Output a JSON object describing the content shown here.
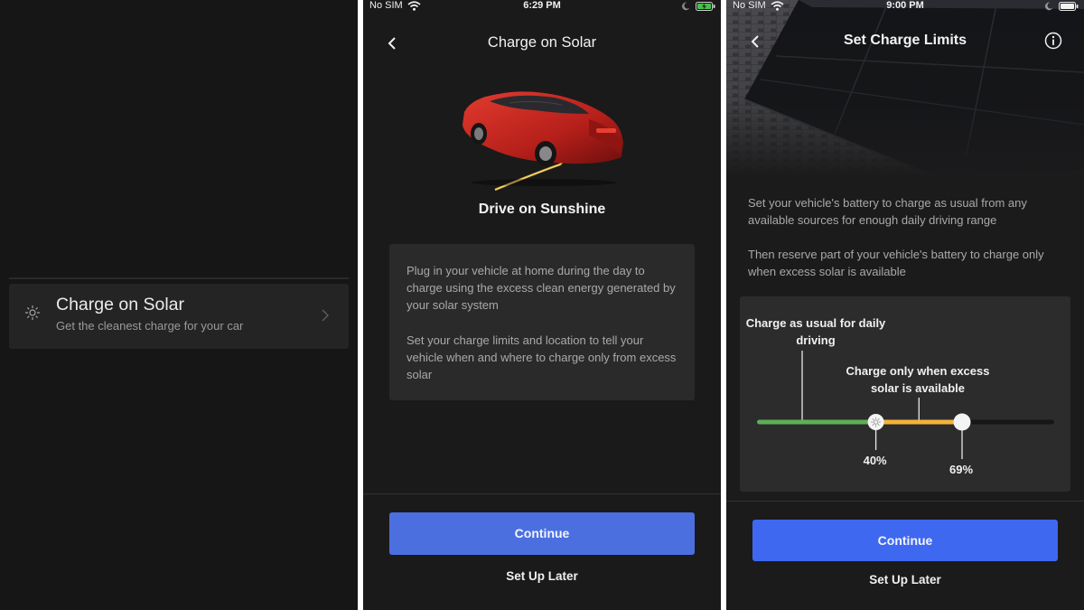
{
  "panel_a": {
    "menu_item": {
      "icon": "sun-icon",
      "title": "Charge on Solar",
      "subtitle": "Get the cleanest charge for your car"
    }
  },
  "panel_b": {
    "status_bar": {
      "carrier": "No SIM",
      "time": "6:29 PM"
    },
    "nav_title": "Charge on Solar",
    "headline": "Drive on Sunshine",
    "info_paragraphs": [
      "Plug in your vehicle at home during the day to charge using the excess clean energy generated by your solar system",
      "Set your charge limits and location to tell your vehicle when and where to charge only from excess solar"
    ],
    "continue_label": "Continue",
    "later_label": "Set Up Later",
    "button_color": "#4c6fe0"
  },
  "panel_c": {
    "status_bar": {
      "carrier": "No SIM",
      "time": "9:00 PM"
    },
    "nav_title": "Set Charge Limits",
    "description": [
      "Set your vehicle's battery to charge as usual from any available sources for enough daily driving range",
      "Then reserve part of your vehicle's battery to charge only when excess solar is available"
    ],
    "slider": {
      "label_usual": "Charge as usual for daily driving",
      "label_solar": "Charge only when excess solar is available",
      "usual_limit_pct": 40,
      "solar_limit_pct": 69,
      "usual_limit_label": "40%",
      "solar_limit_label": "69%",
      "usual_color": "#5fae57",
      "solar_color": "#f2b43a"
    },
    "continue_label": "Continue",
    "later_label": "Set Up Later",
    "button_color": "#3f68f0"
  }
}
